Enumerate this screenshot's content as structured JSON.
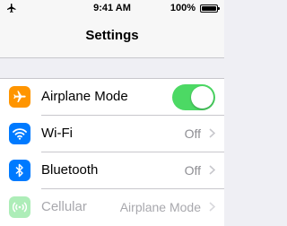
{
  "status_bar": {
    "time": "9:41 AM",
    "battery": "100%",
    "battery_level": 1.0,
    "signal_icon": "airplane-icon"
  },
  "nav": {
    "title": "Settings"
  },
  "settings": [
    {
      "label": "Airplane Mode",
      "icon": "airplane-icon",
      "icon_color": "#ff9500",
      "control": "toggle",
      "toggle_on": true
    },
    {
      "label": "Wi-Fi",
      "icon": "wifi-icon",
      "icon_color": "#007aff",
      "value": "Off"
    },
    {
      "label": "Bluetooth",
      "icon": "bluetooth-icon",
      "icon_color": "#007aff",
      "value": "Off"
    },
    {
      "label": "Cellular",
      "icon": "cellular-icon",
      "icon_color": "#4cd964",
      "value": "Airplane Mode",
      "disabled": true
    }
  ],
  "colors": {
    "toggle_on": "#4cd964",
    "secondary_text": "#8e8e93",
    "background": "#efeff4"
  }
}
